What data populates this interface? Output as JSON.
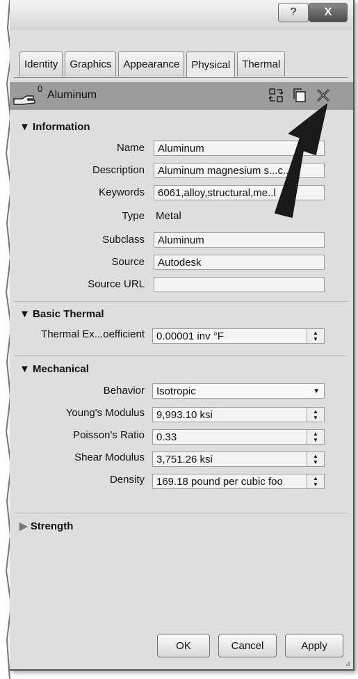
{
  "window": {
    "help_symbol": "?",
    "close_symbol": "X"
  },
  "tabs": [
    {
      "label": "Identity",
      "active": false
    },
    {
      "label": "Graphics",
      "active": false
    },
    {
      "label": "Appearance",
      "active": false
    },
    {
      "label": "Physical",
      "active": true
    },
    {
      "label": "Thermal",
      "active": false
    }
  ],
  "asset": {
    "count": "0",
    "name": "Aluminum",
    "header_icons": [
      "duplicate-icon",
      "copy-icon",
      "delete-icon"
    ]
  },
  "information": {
    "heading": "Information",
    "expanded": true,
    "name_label": "Name",
    "name_value": "Aluminum",
    "description_label": "Description",
    "description_value": "Aluminum magnesium s...c...",
    "keywords_label": "Keywords",
    "keywords_value": "6061,alloy,structural,me..l",
    "type_label": "Type",
    "type_value": "Metal",
    "subclass_label": "Subclass",
    "subclass_value": "Aluminum",
    "source_label": "Source",
    "source_value": "Autodesk",
    "source_url_label": "Source URL",
    "source_url_value": ""
  },
  "basic_thermal": {
    "heading": "Basic Thermal",
    "expanded": true,
    "thermal_label": "Thermal Ex...oefficient",
    "thermal_value": "0.00001 inv °F"
  },
  "mechanical": {
    "heading": "Mechanical",
    "expanded": true,
    "behavior_label": "Behavior",
    "behavior_value": "Isotropic",
    "youngs_label": "Young's Modulus",
    "youngs_value": "9,993.10 ksi",
    "poisson_label": "Poisson's Ratio",
    "poisson_value": "0.33",
    "shear_label": "Shear Modulus",
    "shear_value": "3,751.26 ksi",
    "density_label": "Density",
    "density_value": "169.18 pound per cubic foo"
  },
  "strength": {
    "heading": "Strength",
    "expanded": false
  },
  "buttons": {
    "ok": "OK",
    "cancel": "Cancel",
    "apply": "Apply"
  }
}
